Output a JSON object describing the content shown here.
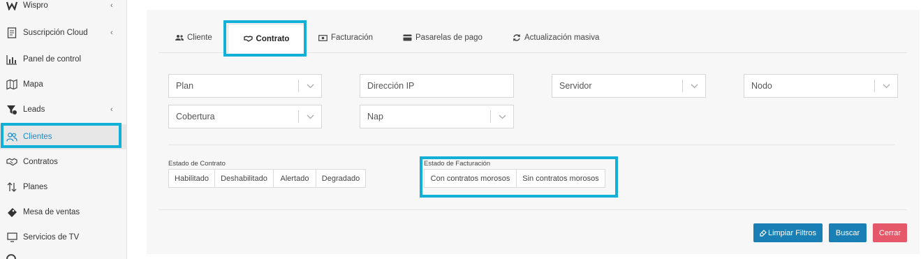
{
  "sidebar": {
    "items": [
      {
        "label": "Wispro",
        "icon": "wispro-logo-icon",
        "chevron": true
      },
      {
        "label": "Suscripción Cloud",
        "icon": "receipt-icon",
        "chevron": true
      },
      {
        "label": "Panel de control",
        "icon": "bar-chart-icon",
        "chevron": false
      },
      {
        "label": "Mapa",
        "icon": "map-icon",
        "chevron": false
      },
      {
        "label": "Leads",
        "icon": "funnel-icon",
        "chevron": true
      },
      {
        "label": "Clientes",
        "icon": "users-icon",
        "chevron": false,
        "active": true
      },
      {
        "label": "Contratos",
        "icon": "handshake-icon",
        "chevron": false
      },
      {
        "label": "Planes",
        "icon": "sort-arrows-icon",
        "chevron": false
      },
      {
        "label": "Mesa de ventas",
        "icon": "tag-icon",
        "chevron": false
      },
      {
        "label": "Servicios de TV",
        "icon": "tv-icon",
        "chevron": false
      }
    ],
    "chevron_glyph": "‹"
  },
  "tabs": [
    {
      "label": "Cliente",
      "icon": "users-icon"
    },
    {
      "label": "Contrato",
      "icon": "handshake-icon",
      "active": true
    },
    {
      "label": "Facturación",
      "icon": "money-icon"
    },
    {
      "label": "Pasarelas de pago",
      "icon": "credit-card-icon"
    },
    {
      "label": "Actualización masiva",
      "icon": "refresh-icon"
    }
  ],
  "filters": {
    "plan": "Plan",
    "ip": "Dirección IP",
    "servidor": "Servidor",
    "nodo": "Nodo",
    "cobertura": "Cobertura",
    "nap": "Nap"
  },
  "estado_contrato": {
    "label": "Estado de Contrato",
    "options": [
      "Habilitado",
      "Deshabilitado",
      "Alertado",
      "Degradado"
    ]
  },
  "estado_facturacion": {
    "label": "Estado de Facturación",
    "options": [
      "Con contratos morosos",
      "Sin contratos morosos"
    ]
  },
  "actions": {
    "clear": "Limpiar Filtros",
    "search": "Buscar",
    "close": "Cerrar"
  },
  "colors": {
    "accent": "#1a8ac9",
    "highlight": "#12afd6",
    "primary_button": "#1a7fb5",
    "danger_button": "#e5586a"
  }
}
